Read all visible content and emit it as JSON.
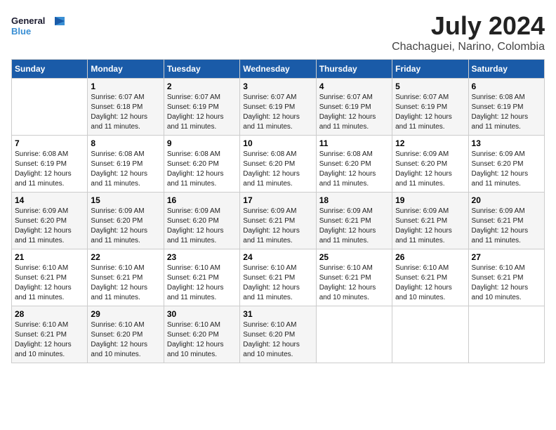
{
  "header": {
    "logo_general": "General",
    "logo_blue": "Blue",
    "title": "July 2024",
    "location": "Chachaguei, Narino, Colombia"
  },
  "days_of_week": [
    "Sunday",
    "Monday",
    "Tuesday",
    "Wednesday",
    "Thursday",
    "Friday",
    "Saturday"
  ],
  "weeks": [
    [
      {
        "day": "",
        "sunrise": "",
        "sunset": "",
        "daylight": ""
      },
      {
        "day": "1",
        "sunrise": "Sunrise: 6:07 AM",
        "sunset": "Sunset: 6:18 PM",
        "daylight": "Daylight: 12 hours and 11 minutes."
      },
      {
        "day": "2",
        "sunrise": "Sunrise: 6:07 AM",
        "sunset": "Sunset: 6:19 PM",
        "daylight": "Daylight: 12 hours and 11 minutes."
      },
      {
        "day": "3",
        "sunrise": "Sunrise: 6:07 AM",
        "sunset": "Sunset: 6:19 PM",
        "daylight": "Daylight: 12 hours and 11 minutes."
      },
      {
        "day": "4",
        "sunrise": "Sunrise: 6:07 AM",
        "sunset": "Sunset: 6:19 PM",
        "daylight": "Daylight: 12 hours and 11 minutes."
      },
      {
        "day": "5",
        "sunrise": "Sunrise: 6:07 AM",
        "sunset": "Sunset: 6:19 PM",
        "daylight": "Daylight: 12 hours and 11 minutes."
      },
      {
        "day": "6",
        "sunrise": "Sunrise: 6:08 AM",
        "sunset": "Sunset: 6:19 PM",
        "daylight": "Daylight: 12 hours and 11 minutes."
      }
    ],
    [
      {
        "day": "7",
        "sunrise": "Sunrise: 6:08 AM",
        "sunset": "Sunset: 6:19 PM",
        "daylight": "Daylight: 12 hours and 11 minutes."
      },
      {
        "day": "8",
        "sunrise": "Sunrise: 6:08 AM",
        "sunset": "Sunset: 6:19 PM",
        "daylight": "Daylight: 12 hours and 11 minutes."
      },
      {
        "day": "9",
        "sunrise": "Sunrise: 6:08 AM",
        "sunset": "Sunset: 6:20 PM",
        "daylight": "Daylight: 12 hours and 11 minutes."
      },
      {
        "day": "10",
        "sunrise": "Sunrise: 6:08 AM",
        "sunset": "Sunset: 6:20 PM",
        "daylight": "Daylight: 12 hours and 11 minutes."
      },
      {
        "day": "11",
        "sunrise": "Sunrise: 6:08 AM",
        "sunset": "Sunset: 6:20 PM",
        "daylight": "Daylight: 12 hours and 11 minutes."
      },
      {
        "day": "12",
        "sunrise": "Sunrise: 6:09 AM",
        "sunset": "Sunset: 6:20 PM",
        "daylight": "Daylight: 12 hours and 11 minutes."
      },
      {
        "day": "13",
        "sunrise": "Sunrise: 6:09 AM",
        "sunset": "Sunset: 6:20 PM",
        "daylight": "Daylight: 12 hours and 11 minutes."
      }
    ],
    [
      {
        "day": "14",
        "sunrise": "Sunrise: 6:09 AM",
        "sunset": "Sunset: 6:20 PM",
        "daylight": "Daylight: 12 hours and 11 minutes."
      },
      {
        "day": "15",
        "sunrise": "Sunrise: 6:09 AM",
        "sunset": "Sunset: 6:20 PM",
        "daylight": "Daylight: 12 hours and 11 minutes."
      },
      {
        "day": "16",
        "sunrise": "Sunrise: 6:09 AM",
        "sunset": "Sunset: 6:20 PM",
        "daylight": "Daylight: 12 hours and 11 minutes."
      },
      {
        "day": "17",
        "sunrise": "Sunrise: 6:09 AM",
        "sunset": "Sunset: 6:21 PM",
        "daylight": "Daylight: 12 hours and 11 minutes."
      },
      {
        "day": "18",
        "sunrise": "Sunrise: 6:09 AM",
        "sunset": "Sunset: 6:21 PM",
        "daylight": "Daylight: 12 hours and 11 minutes."
      },
      {
        "day": "19",
        "sunrise": "Sunrise: 6:09 AM",
        "sunset": "Sunset: 6:21 PM",
        "daylight": "Daylight: 12 hours and 11 minutes."
      },
      {
        "day": "20",
        "sunrise": "Sunrise: 6:09 AM",
        "sunset": "Sunset: 6:21 PM",
        "daylight": "Daylight: 12 hours and 11 minutes."
      }
    ],
    [
      {
        "day": "21",
        "sunrise": "Sunrise: 6:10 AM",
        "sunset": "Sunset: 6:21 PM",
        "daylight": "Daylight: 12 hours and 11 minutes."
      },
      {
        "day": "22",
        "sunrise": "Sunrise: 6:10 AM",
        "sunset": "Sunset: 6:21 PM",
        "daylight": "Daylight: 12 hours and 11 minutes."
      },
      {
        "day": "23",
        "sunrise": "Sunrise: 6:10 AM",
        "sunset": "Sunset: 6:21 PM",
        "daylight": "Daylight: 12 hours and 11 minutes."
      },
      {
        "day": "24",
        "sunrise": "Sunrise: 6:10 AM",
        "sunset": "Sunset: 6:21 PM",
        "daylight": "Daylight: 12 hours and 11 minutes."
      },
      {
        "day": "25",
        "sunrise": "Sunrise: 6:10 AM",
        "sunset": "Sunset: 6:21 PM",
        "daylight": "Daylight: 12 hours and 10 minutes."
      },
      {
        "day": "26",
        "sunrise": "Sunrise: 6:10 AM",
        "sunset": "Sunset: 6:21 PM",
        "daylight": "Daylight: 12 hours and 10 minutes."
      },
      {
        "day": "27",
        "sunrise": "Sunrise: 6:10 AM",
        "sunset": "Sunset: 6:21 PM",
        "daylight": "Daylight: 12 hours and 10 minutes."
      }
    ],
    [
      {
        "day": "28",
        "sunrise": "Sunrise: 6:10 AM",
        "sunset": "Sunset: 6:21 PM",
        "daylight": "Daylight: 12 hours and 10 minutes."
      },
      {
        "day": "29",
        "sunrise": "Sunrise: 6:10 AM",
        "sunset": "Sunset: 6:20 PM",
        "daylight": "Daylight: 12 hours and 10 minutes."
      },
      {
        "day": "30",
        "sunrise": "Sunrise: 6:10 AM",
        "sunset": "Sunset: 6:20 PM",
        "daylight": "Daylight: 12 hours and 10 minutes."
      },
      {
        "day": "31",
        "sunrise": "Sunrise: 6:10 AM",
        "sunset": "Sunset: 6:20 PM",
        "daylight": "Daylight: 12 hours and 10 minutes."
      },
      {
        "day": "",
        "sunrise": "",
        "sunset": "",
        "daylight": ""
      },
      {
        "day": "",
        "sunrise": "",
        "sunset": "",
        "daylight": ""
      },
      {
        "day": "",
        "sunrise": "",
        "sunset": "",
        "daylight": ""
      }
    ]
  ]
}
